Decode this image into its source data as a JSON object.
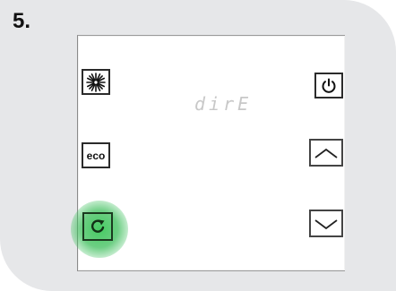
{
  "step": {
    "label": "5."
  },
  "display": {
    "text": "dirE"
  },
  "buttons": {
    "sun": {
      "icon": "sun-icon"
    },
    "eco": {
      "label": "eco"
    },
    "refresh": {
      "icon": "refresh-icon",
      "highlight_color": "#3cc85a"
    },
    "power": {
      "icon": "power-icon"
    },
    "up": {
      "icon": "chevron-up-icon"
    },
    "down": {
      "icon": "chevron-down-icon"
    }
  }
}
